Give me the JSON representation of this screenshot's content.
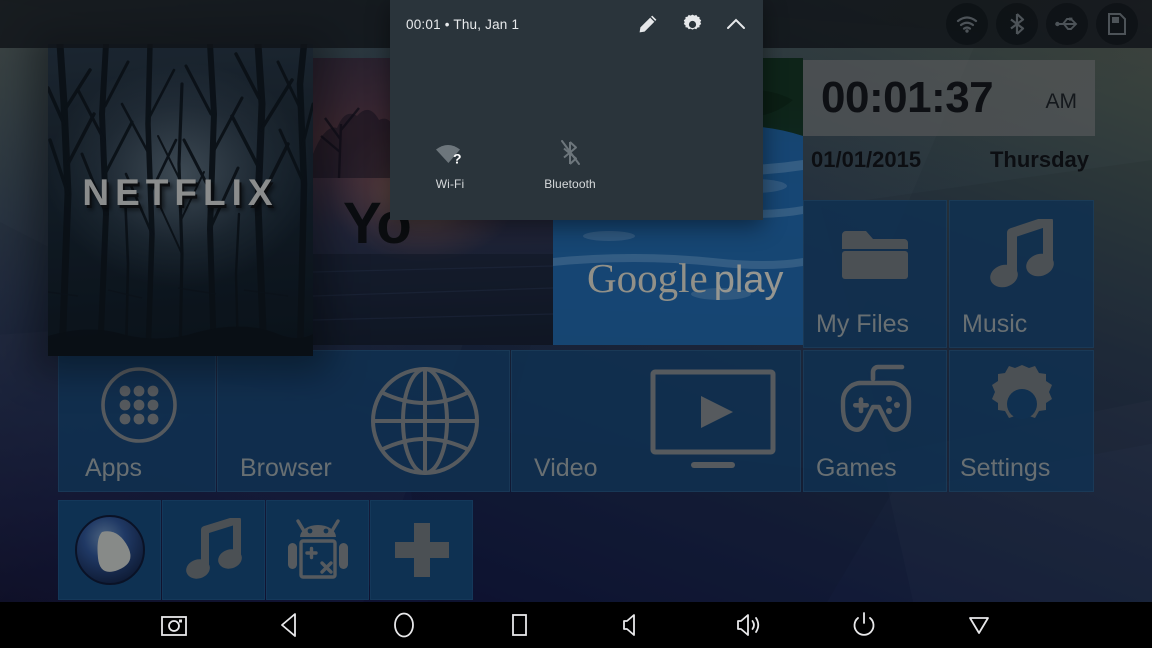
{
  "status_bar": {
    "icons": [
      {
        "name": "wifi-status-icon",
        "label": "Wi-Fi"
      },
      {
        "name": "bluetooth-status-icon",
        "label": "Bluetooth"
      },
      {
        "name": "usb-status-icon",
        "label": "USB"
      },
      {
        "name": "sdcard-status-icon",
        "label": "SD Card"
      }
    ]
  },
  "quick_settings": {
    "header_text": "00:01  •  Thu, Jan 1",
    "edit_label": "Edit",
    "settings_label": "Settings",
    "collapse_label": "Collapse",
    "tiles": [
      {
        "label": "Wi-Fi",
        "icon": "wifi-question-icon",
        "state": "disconnected"
      },
      {
        "label": "Bluetooth",
        "icon": "bluetooth-off-icon",
        "state": "off"
      }
    ],
    "panel_color": "#2a343b"
  },
  "cards": {
    "netflix": {
      "label": "NETFLIX"
    },
    "youtube": {
      "label": "Yo"
    },
    "google_play": {
      "brand": "Google",
      "suffix": "play"
    }
  },
  "clock_widget": {
    "time": "00:01:37",
    "ampm": "AM",
    "date": "01/01/2015",
    "day": "Thursday"
  },
  "tiles": [
    {
      "id": "myfiles",
      "label": "My Files",
      "icon": "folder-icon"
    },
    {
      "id": "music",
      "label": "Music",
      "icon": "music-note-icon"
    },
    {
      "id": "apps",
      "label": "Apps",
      "icon": "apps-grid-icon"
    },
    {
      "id": "browser",
      "label": "Browser",
      "icon": "globe-icon"
    },
    {
      "id": "video",
      "label": "Video",
      "icon": "tv-play-icon"
    },
    {
      "id": "games",
      "label": "Games",
      "icon": "gamepad-icon"
    },
    {
      "id": "settings",
      "label": "Settings",
      "icon": "gear-icon"
    }
  ],
  "dock": [
    {
      "id": "dock-1",
      "icon": "media-player-icon",
      "label": "Media Player"
    },
    {
      "id": "dock-2",
      "icon": "music-note-icon",
      "label": "Music"
    },
    {
      "id": "dock-3",
      "icon": "android-calc-icon",
      "label": "Calculator"
    },
    {
      "id": "dock-4",
      "icon": "plus-icon",
      "label": "Add Shortcut"
    }
  ],
  "navigation_bar": [
    {
      "name": "screenshot-button",
      "icon": "camera-icon",
      "label": "Screenshot"
    },
    {
      "name": "back-button",
      "icon": "back-triangle-icon",
      "label": "Back"
    },
    {
      "name": "home-button",
      "icon": "home-circle-icon",
      "label": "Home"
    },
    {
      "name": "recents-button",
      "icon": "recents-square-icon",
      "label": "Recents"
    },
    {
      "name": "volume-down-button",
      "icon": "volume-down-icon",
      "label": "Volume Down"
    },
    {
      "name": "volume-up-button",
      "icon": "volume-up-icon",
      "label": "Volume Up"
    },
    {
      "name": "power-button",
      "icon": "power-icon",
      "label": "Power"
    },
    {
      "name": "hide-navbar-button",
      "icon": "chevron-down-icon",
      "label": "Hide"
    }
  ],
  "colors": {
    "tile_blue": "#144270",
    "panel": "#2a343b",
    "navbar": "#000000",
    "icon_grey": "#8d9396"
  }
}
